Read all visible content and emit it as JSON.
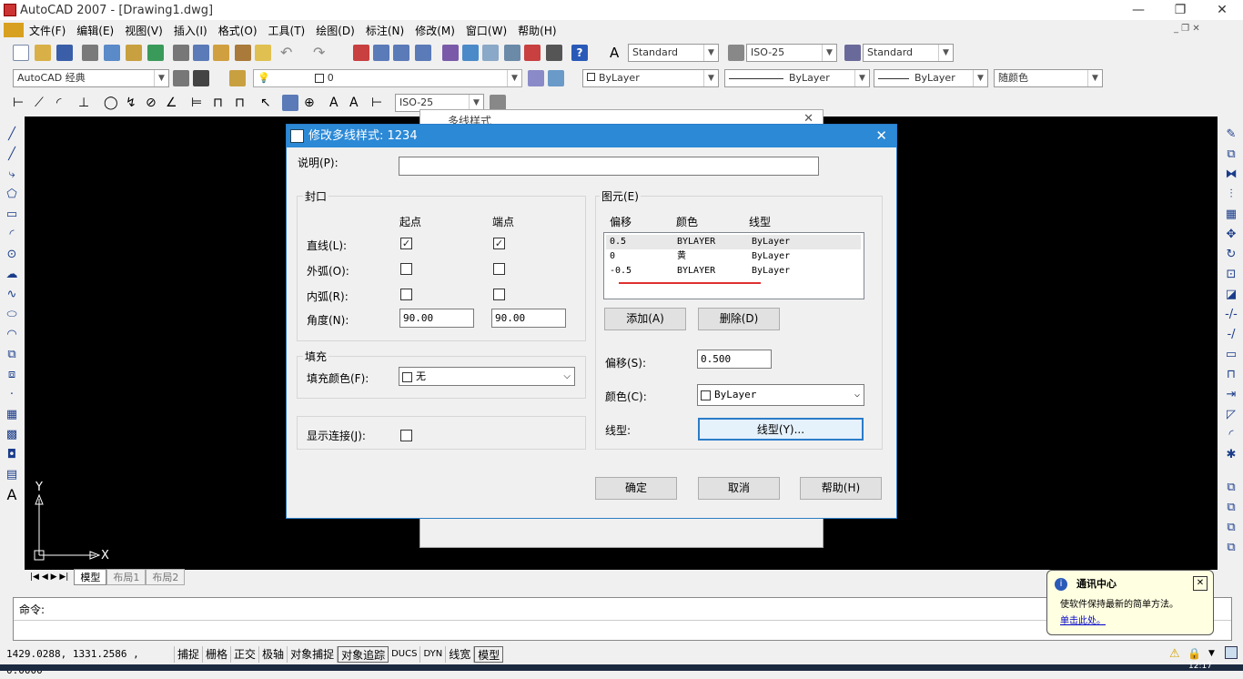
{
  "window": {
    "title": "AutoCAD 2007 - [Drawing1.dwg]",
    "min": "—",
    "max": "❐",
    "close": "✕"
  },
  "menu": [
    "文件(F)",
    "编辑(E)",
    "视图(V)",
    "插入(I)",
    "格式(O)",
    "工具(T)",
    "绘图(D)",
    "标注(N)",
    "修改(M)",
    "窗口(W)",
    "帮助(H)"
  ],
  "toolbar": {
    "text_style": "Standard",
    "dim_style": "ISO-25",
    "table_style": "Standard",
    "workspace": "AutoCAD 经典",
    "layer": "0",
    "color": "ByLayer",
    "linetype": "ByLayer",
    "lineweight": "ByLayer",
    "plotstyle": "随颜色",
    "dim_style2": "ISO-25"
  },
  "canvas": {
    "ucs_x": "X",
    "ucs_y": "Y"
  },
  "tabs": [
    "模型",
    "布局1",
    "布局2"
  ],
  "command": {
    "prompt": "命令:"
  },
  "status": {
    "coords": "1429.0288, 1331.2586 , 0.0000",
    "toggles": [
      "捕捉",
      "栅格",
      "正交",
      "极轴",
      "对象捕捉",
      "对象追踪",
      "DUCS",
      "DYN",
      "线宽",
      "模型"
    ],
    "time": "12:17"
  },
  "bg_dialog": {
    "title": "多线样式"
  },
  "dialog": {
    "title": "修改多线样式: 1234",
    "description_label": "说明(P):",
    "description_value": "",
    "caps": {
      "title": "封口",
      "start": "起点",
      "end": "端点",
      "rows": [
        {
          "label": "直线(L):",
          "start": true,
          "end": true
        },
        {
          "label": "外弧(O):",
          "start": false,
          "end": false
        },
        {
          "label": "内弧(R):",
          "start": false,
          "end": false
        }
      ],
      "angle_label": "角度(N):",
      "angle_start": "90.00",
      "angle_end": "90.00"
    },
    "fill": {
      "title": "填充",
      "color_label": "填充颜色(F):",
      "color_value": "无"
    },
    "joints": {
      "label": "显示连接(J):",
      "checked": false
    },
    "elements": {
      "title": "图元(E)",
      "headers": [
        "偏移",
        "颜色",
        "线型"
      ],
      "rows": [
        {
          "offset": "0.5",
          "color": "BYLAYER",
          "linetype": "ByLayer"
        },
        {
          "offset": "0",
          "color": "黄",
          "linetype": "ByLayer"
        },
        {
          "offset": "-0.5",
          "color": "BYLAYER",
          "linetype": "ByLayer"
        }
      ],
      "add": "添加(A)",
      "delete": "删除(D)",
      "offset_label": "偏移(S):",
      "offset_value": "0.500",
      "color_label": "颜色(C):",
      "color_value": "ByLayer",
      "linetype_label": "线型:",
      "linetype_button": "线型(Y)..."
    },
    "ok": "确定",
    "cancel": "取消",
    "help": "帮助(H)"
  },
  "balloon": {
    "title": "通讯中心",
    "body": "使软件保持最新的简单方法。",
    "link": "单击此处。",
    "close": "✕"
  },
  "colors": {
    "accent": "#2b89d6",
    "canvas": "#000000",
    "redline": "#e03030"
  }
}
